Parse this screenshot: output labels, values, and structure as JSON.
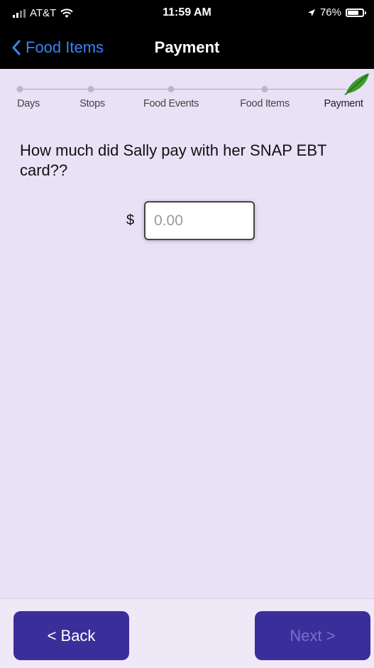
{
  "status_bar": {
    "carrier": "AT&T",
    "time": "11:59 AM",
    "battery_percent": "76%",
    "battery_level": 0.76,
    "icons": [
      "signal-icon",
      "wifi-icon",
      "location-icon",
      "battery-icon"
    ]
  },
  "nav": {
    "back_label": "Food Items",
    "title": "Payment"
  },
  "stepper": {
    "steps": [
      "Days",
      "Stops",
      "Food Events",
      "Food Items",
      "Payment"
    ],
    "active_index": 4,
    "active_icon": "leaf-icon"
  },
  "form": {
    "question": "How much did Sally pay with her SNAP EBT card??",
    "currency_symbol": "$",
    "amount_value": "",
    "amount_placeholder": "0.00"
  },
  "footer": {
    "back_label": "< Back",
    "next_label": "Next >",
    "next_enabled": false
  },
  "colors": {
    "background": "#e9e1f6",
    "button": "#3a2f9a",
    "link": "#3b82f6"
  }
}
